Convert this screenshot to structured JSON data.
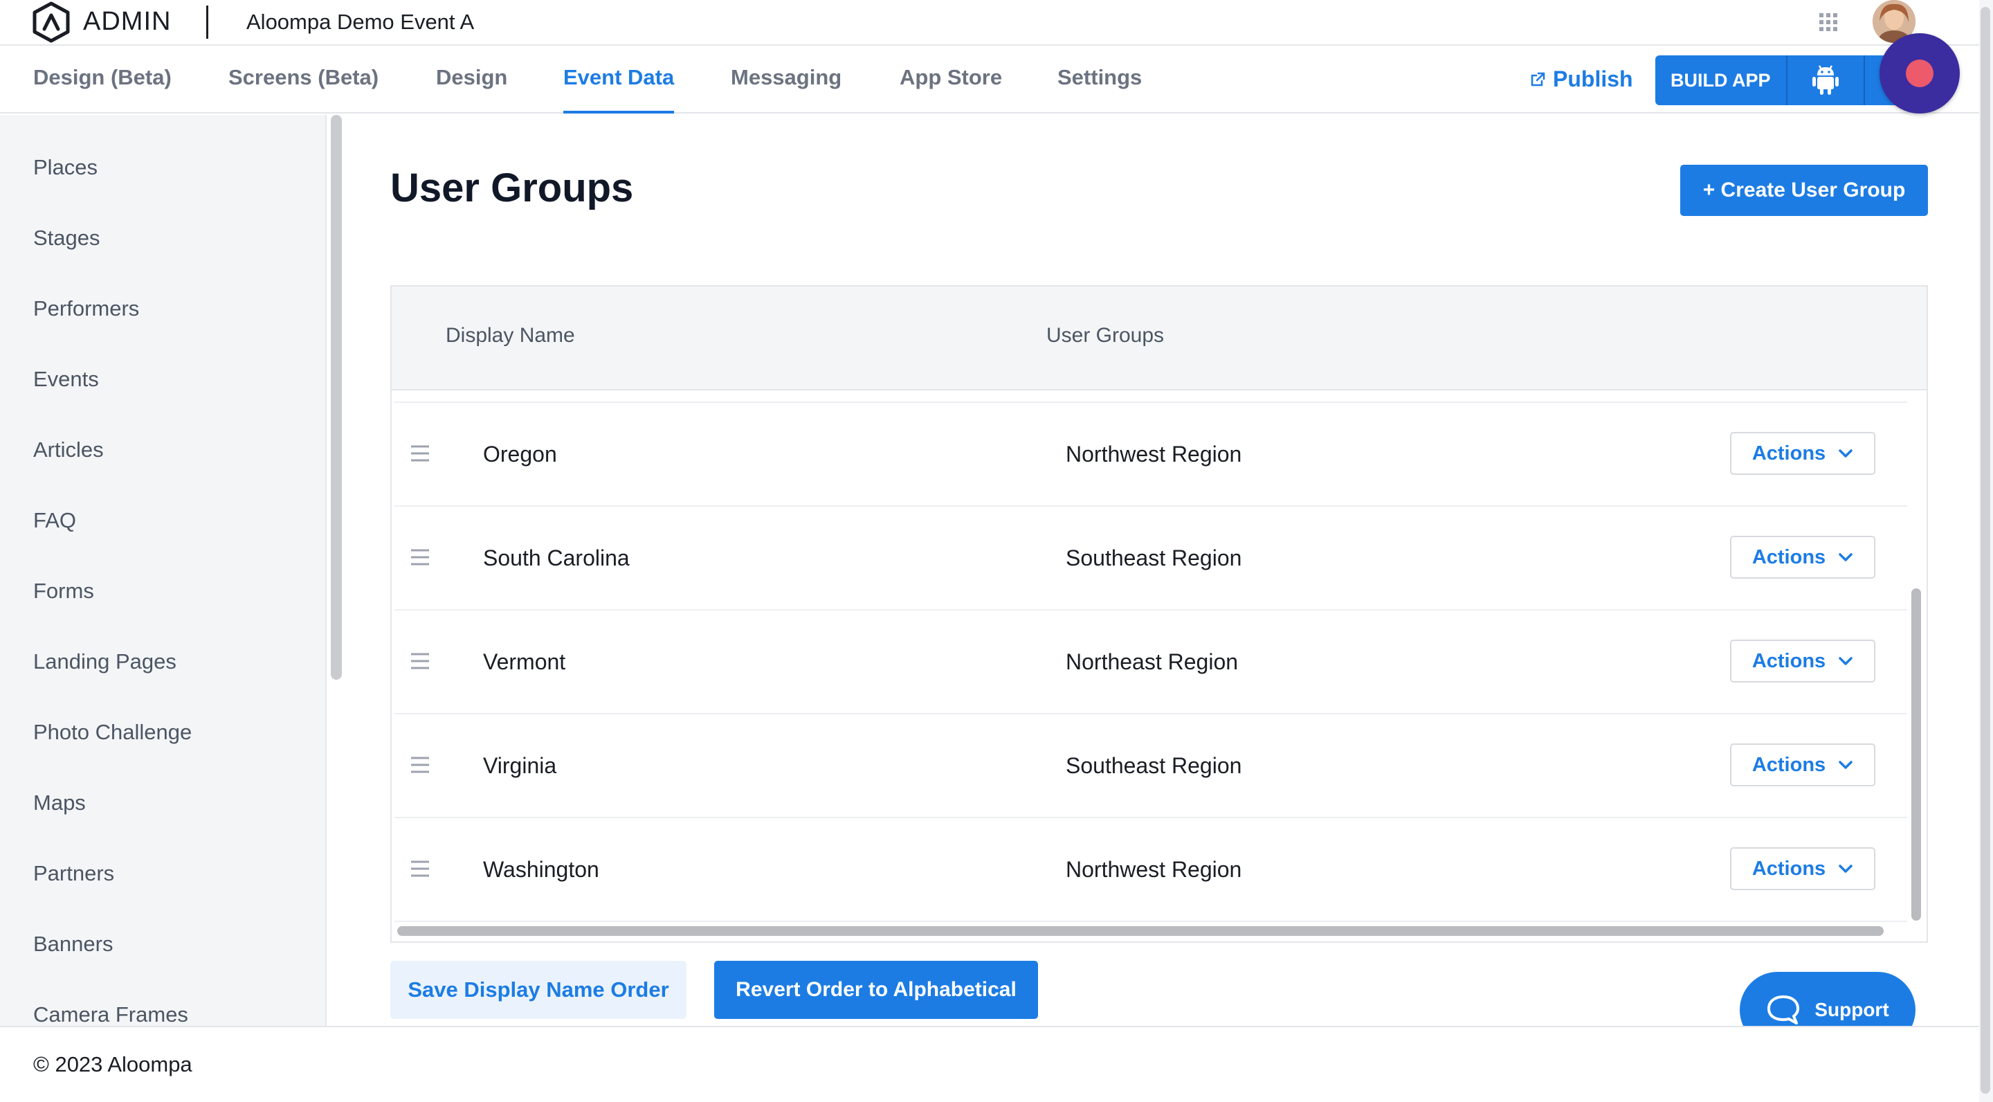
{
  "header": {
    "logo_text": "ADMIN",
    "event_name": "Aloompa Demo Event A"
  },
  "nav": {
    "tabs": [
      {
        "label": "Design (Beta)"
      },
      {
        "label": "Screens (Beta)"
      },
      {
        "label": "Design"
      },
      {
        "label": "Event Data"
      },
      {
        "label": "Messaging"
      },
      {
        "label": "App Store"
      },
      {
        "label": "Settings"
      }
    ],
    "active_tab": "Event Data",
    "publish_label": "Publish",
    "build_label": "BUILD APP"
  },
  "sidebar": {
    "items": [
      {
        "label": "Places"
      },
      {
        "label": "Stages"
      },
      {
        "label": "Performers"
      },
      {
        "label": "Events"
      },
      {
        "label": "Articles"
      },
      {
        "label": "FAQ"
      },
      {
        "label": "Forms"
      },
      {
        "label": "Landing Pages"
      },
      {
        "label": "Photo Challenge"
      },
      {
        "label": "Maps"
      },
      {
        "label": "Partners"
      },
      {
        "label": "Banners"
      },
      {
        "label": "Camera Frames"
      }
    ]
  },
  "main": {
    "title": "User Groups",
    "create_label": "+ Create User Group",
    "table": {
      "columns": [
        "Display Name",
        "User Groups"
      ],
      "rows": [
        {
          "name": "Oregon",
          "group": "Northwest Region",
          "action": "Actions"
        },
        {
          "name": "South Carolina",
          "group": "Southeast Region",
          "action": "Actions"
        },
        {
          "name": "Vermont",
          "group": "Northeast Region",
          "action": "Actions"
        },
        {
          "name": "Virginia",
          "group": "Southeast Region",
          "action": "Actions"
        },
        {
          "name": "Washington",
          "group": "Northwest Region",
          "action": "Actions"
        }
      ]
    },
    "save_label": "Save Display Name Order",
    "revert_label": "Revert Order to Alphabetical"
  },
  "support_label": "Support",
  "footer": {
    "copyright": "© 2023 Aloompa"
  },
  "colors": {
    "accent": "#1c7ce4",
    "record": "#3b2ca0",
    "record_dot": "#ec5a6b"
  },
  "icons": [
    "aloompa-logo-icon",
    "apps-grid-icon",
    "external-link-icon",
    "android-icon",
    "apple-icon",
    "record-icon",
    "drag-handle-icon",
    "chevron-down-icon",
    "chat-bubble-icon"
  ]
}
